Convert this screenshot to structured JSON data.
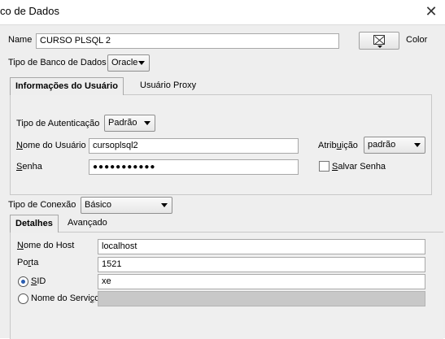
{
  "window": {
    "title": "co de Dados",
    "close_glyph": "✕"
  },
  "connection": {
    "name_label": "Name",
    "name_value": "CURSO PLSQL 2",
    "color_label": "Color",
    "db_type_label": "Tipo de Banco de Dados",
    "db_type_value": "Oracle"
  },
  "user_tabs": [
    {
      "label": "Informações do Usuário",
      "active": true
    },
    {
      "label": "Usuário Proxy",
      "active": false
    }
  ],
  "user_info": {
    "auth_type_label": "Tipo de Autenticação",
    "auth_type_value": "Padrão",
    "username_label_pre": "N",
    "username_label_rest": "ome do Usuário",
    "username_value": "cursoplsql2",
    "password_label_pre": "S",
    "password_label_rest": "enha",
    "password_value": "●●●●●●●●●●●",
    "role_label_pre": "Atrib",
    "role_label_u": "u",
    "role_label_rest": "ição",
    "role_value": "padrão",
    "save_password_label_pre": "S",
    "save_password_label_rest": "alvar Senha",
    "save_password_checked": false
  },
  "connection_type": {
    "label": "Tipo de Conexão",
    "value": "Básico"
  },
  "detail_tabs": [
    {
      "label": "Detalhes",
      "active": true
    },
    {
      "label": "Avançado",
      "active": false
    }
  ],
  "details": {
    "host_label_pre": "N",
    "host_label_u": "o",
    "host_label_rest": "me do Host",
    "host_value": "localhost",
    "port_label_pre": "Po",
    "port_label_u": "r",
    "port_label_rest": "ta",
    "port_value": "1521",
    "sid_label_pre": "S",
    "sid_label_rest": "ID",
    "sid_value": "xe",
    "sid_selected": true,
    "service_label_pre": "Nome do Servi",
    "service_label_u": "ç",
    "service_label_rest": "o",
    "service_value": ""
  }
}
